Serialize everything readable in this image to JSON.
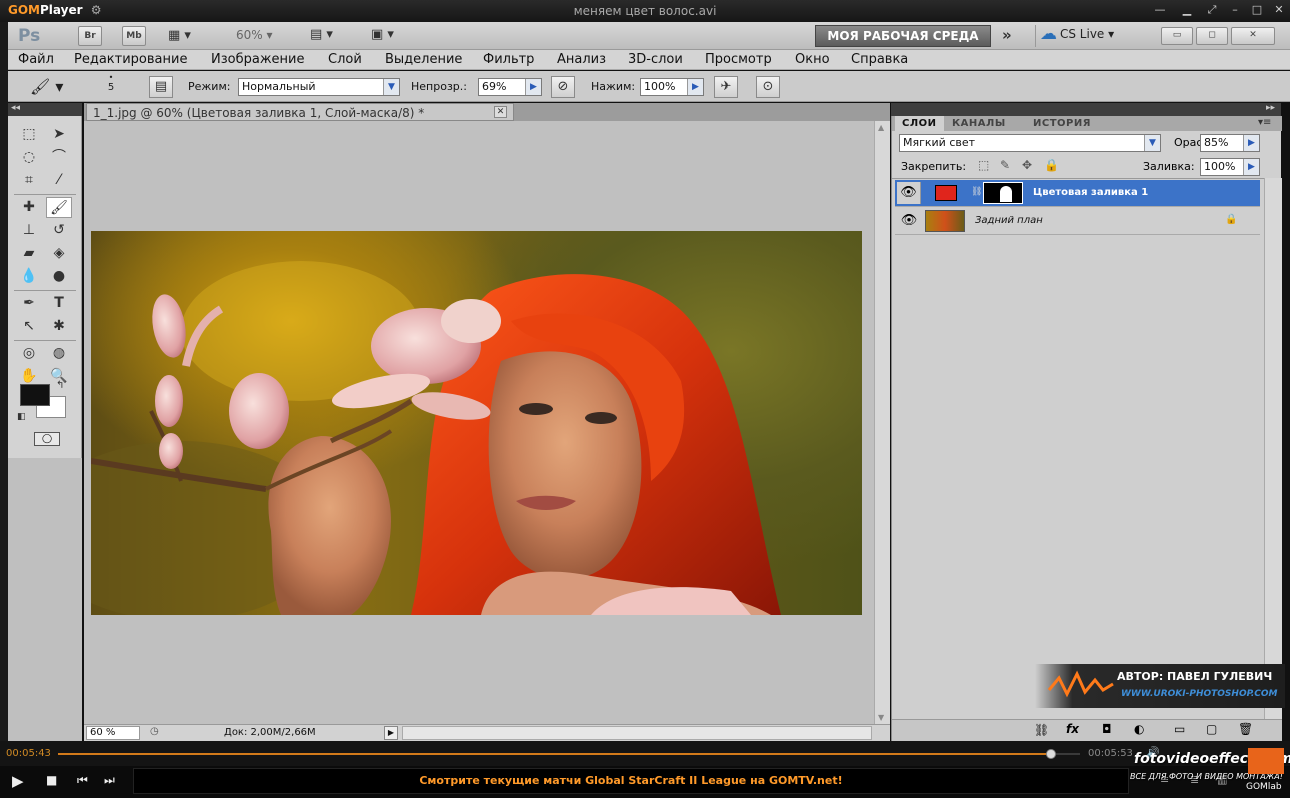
{
  "player": {
    "logo": "GOM",
    "logo_suffix": "Player",
    "filename": "меняем цвет волос.avi",
    "time_current": "00:05:43",
    "time_total": "00:05:53",
    "ticker": "Смотрите текущие матчи Global StarCraft II League на GOMTV.net!",
    "gomlab": "GOMlab",
    "progress_fraction": 0.972
  },
  "photoshop": {
    "appbar": {
      "logo": "Ps",
      "bridge": "Br",
      "minibridge": "Mb",
      "zoom": "60%",
      "workspace": "МОЯ РАБОЧАЯ СРЕДА",
      "cslive": "CS Live"
    },
    "menu": [
      "Файл",
      "Редактирование",
      "Изображение",
      "Слой",
      "Выделение",
      "Фильтр",
      "Анализ",
      "3D-слои",
      "Просмотр",
      "Окно",
      "Справка"
    ],
    "options": {
      "brush_size": "5",
      "mode_label": "Режим:",
      "mode_value": "Нормальный",
      "opacity_label": "Непрозр.:",
      "opacity_value": "69%",
      "flow_label": "Нажим:",
      "flow_value": "100%"
    },
    "document": {
      "tab_title": "1_1.jpg @ 60% (Цветовая заливка 1, Слой-маска/8) *",
      "status_zoom": "60 %",
      "status_doc": "Док: 2,00M/2,66M"
    },
    "layers_panel": {
      "tabs": [
        "СЛОИ",
        "КАНАЛЫ",
        "ИСТОРИЯ"
      ],
      "blend_mode": "Мягкий свет",
      "opacity_label": "Opacity:",
      "opacity_value": "85%",
      "lock_label": "Закрепить:",
      "fill_label": "Заливка:",
      "fill_value": "100%",
      "layers": [
        {
          "name": "Цветовая заливка 1",
          "selected": true,
          "color": "#e0251c"
        },
        {
          "name": "Задний план",
          "selected": false
        }
      ]
    }
  },
  "watermark": {
    "author": "АВТОР: ПАВЕЛ ГУЛЕВИЧ",
    "site": "WWW.UROKI-PHOTOSHOP.COM",
    "brand": "fotovideoeffect.com",
    "tagline": "ВСЕ ДЛЯ ФОТО И ВИДЕО МОНТАЖА!"
  }
}
